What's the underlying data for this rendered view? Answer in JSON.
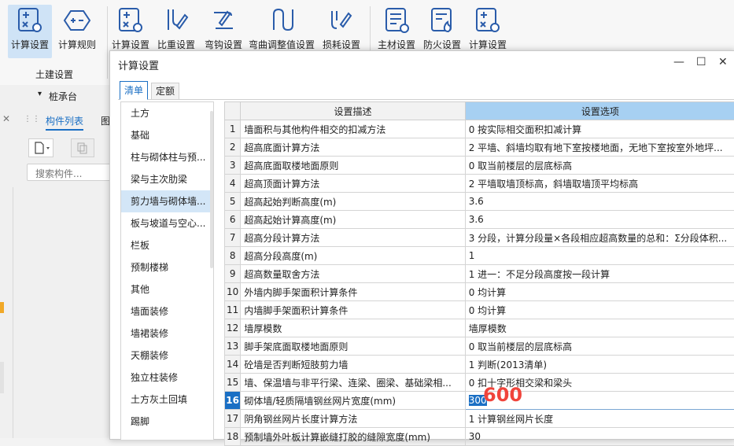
{
  "ribbon": {
    "buttons_left": [
      {
        "label": "计算设置",
        "icon": "calc-settings-icon"
      },
      {
        "label": "计算规则",
        "icon": "calc-rules-icon"
      }
    ],
    "group_label": "土建设置",
    "buttons_right": [
      {
        "label": "计算设置",
        "icon": "calc-settings-icon"
      },
      {
        "label": "比重设置",
        "icon": "weight-settings-icon"
      },
      {
        "label": "弯钩设置",
        "icon": "hook-settings-icon"
      },
      {
        "label": "弯曲调整值设置",
        "icon": "bend-adjust-icon"
      },
      {
        "label": "损耗设置",
        "icon": "loss-settings-icon"
      },
      {
        "label": "主材设置",
        "icon": "main-material-icon"
      },
      {
        "label": "防火设置",
        "icon": "fire-settings-icon"
      },
      {
        "label": "计算设置",
        "icon": "calc-settings-icon"
      }
    ]
  },
  "left_panel": {
    "dropdown_value": "桩承台",
    "tab_component_list": "构件列表",
    "tab_truncated": "图",
    "search_placeholder": "搜索构件..."
  },
  "dialog": {
    "title": "计算设置",
    "tabs": [
      "清单",
      "定额"
    ],
    "active_tab": "清单",
    "categories": [
      "土方",
      "基础",
      "柱与砌体柱与预...",
      "梁与主次肋梁",
      "剪力墙与砌体墙...",
      "板与坡道与空心...",
      "栏板",
      "预制楼梯",
      "其他",
      "墙面装修",
      "墙裙装修",
      "天棚装修",
      "独立柱装修",
      "土方灰土回填",
      "踢脚"
    ],
    "selected_category": "剪力墙与砌体墙...",
    "grid": {
      "header_desc": "设置描述",
      "header_option": "设置选项",
      "rows": [
        {
          "no": "1",
          "desc": "墙面积与其他构件相交的扣减方法",
          "opt": "0 按实际相交面积扣减计算"
        },
        {
          "no": "2",
          "desc": "超高底面计算方法",
          "opt": "2 平墙、斜墙均取有地下室按楼地面，无地下室按室外地坪..."
        },
        {
          "no": "3",
          "desc": "超高底面取楼地面原则",
          "opt": "0 取当前楼层的层底标高"
        },
        {
          "no": "4",
          "desc": "超高顶面计算方法",
          "opt": "2 平墙取墙顶标高，斜墙取墙顶平均标高"
        },
        {
          "no": "5",
          "desc": "超高起始判断高度(m)",
          "opt": "3.6"
        },
        {
          "no": "6",
          "desc": "超高起始计算高度(m)",
          "opt": "3.6"
        },
        {
          "no": "7",
          "desc": "超高分段计算方法",
          "opt": "3 分段，计算分段量×各段相应超高数量的总和：Σ分段体积..."
        },
        {
          "no": "8",
          "desc": "超高分段高度(m)",
          "opt": "1"
        },
        {
          "no": "9",
          "desc": "超高数量取舍方法",
          "opt": "1 进一：不足分段高度按一段计算"
        },
        {
          "no": "10",
          "desc": "外墙内脚手架面积计算条件",
          "opt": "0 均计算"
        },
        {
          "no": "11",
          "desc": "内墙脚手架面积计算条件",
          "opt": "0 均计算"
        },
        {
          "no": "12",
          "desc": "墙厚模数",
          "opt": "墙厚模数"
        },
        {
          "no": "13",
          "desc": "脚手架底面取楼地面原则",
          "opt": "0 取当前楼层的层底标高"
        },
        {
          "no": "14",
          "desc": "砼墙是否判断短肢剪力墙",
          "opt": "1 判断(2013清单)"
        },
        {
          "no": "15",
          "desc": "墙、保温墙与非平行梁、连梁、圈梁、基础梁相...",
          "opt": "0 扣十字形相交梁和梁头"
        },
        {
          "no": "16",
          "desc": "砌体墙/轻质隔墙钢丝网片宽度(mm)",
          "opt": "300"
        },
        {
          "no": "17",
          "desc": "阴角钢丝网片长度计算方法",
          "opt": "1 计算钢丝网片长度"
        },
        {
          "no": "18",
          "desc": "预制墙外叶板计算嵌缝打胶的缝隙宽度(mm)",
          "opt": "30"
        }
      ],
      "active_row": "16"
    },
    "annotation": "600"
  }
}
